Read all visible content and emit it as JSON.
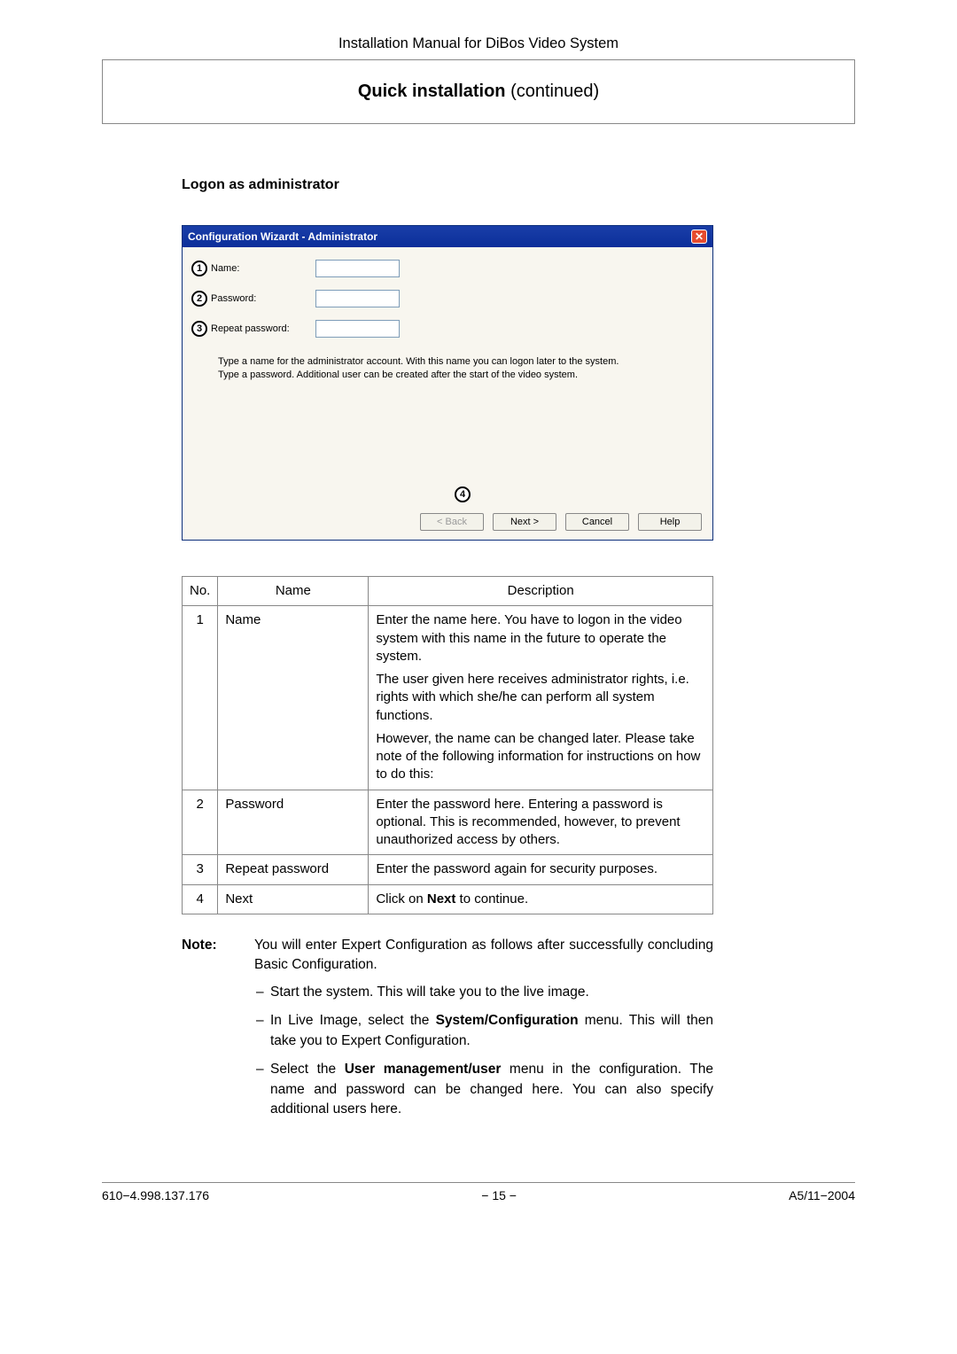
{
  "header": {
    "title": "Installation Manual for DiBos Video System"
  },
  "title_box": {
    "bold": "Quick installation",
    "rest": " (continued)"
  },
  "section": {
    "heading": "Logon as administrator"
  },
  "dialog": {
    "title": "Configuration Wizardt - Administrator",
    "close": "✕",
    "fields": {
      "name_label": "Name:",
      "password_label": "Password:",
      "repeat_label": "Repeat password:",
      "callout1": "1",
      "callout2": "2",
      "callout3": "3",
      "callout4": "4"
    },
    "hint_line1": "Type a name for the administrator account. With this name you can logon later to the system.",
    "hint_line2": "Type a password. Additional user can be created after the start of the video system.",
    "buttons": {
      "back": "< Back",
      "next": "Next >",
      "cancel": "Cancel",
      "help": "Help"
    }
  },
  "table": {
    "headers": {
      "no": "No.",
      "name": "Name",
      "desc": "Description"
    },
    "rows": [
      {
        "no": "1",
        "name": "Name",
        "desc": [
          "Enter the name here. You have to logon in the video system with this name in the future to operate the system.",
          "The user given here receives administrator rights, i.e. rights with which she/he can perform all system functions.",
          "However, the name can be changed later. Please take note of the following information for instructions on how to do this:"
        ]
      },
      {
        "no": "2",
        "name": "Password",
        "desc": [
          "Enter the password here. Entering a password is optional. This is recommended, however, to prevent unauthorized access by others."
        ]
      },
      {
        "no": "3",
        "name": "Repeat password",
        "desc": [
          "Enter the password again for security purposes."
        ]
      },
      {
        "no": "4",
        "name": "Next",
        "desc_html": {
          "pre": "Click on ",
          "bold": "Next",
          "post": " to continue."
        }
      }
    ]
  },
  "note": {
    "label": "Note:",
    "intro": "You will enter Expert Configuration as follows after successfully concluding Basic Configuration.",
    "items": [
      {
        "plain": "Start the system. This will take you to the live image."
      },
      {
        "pre": "In Live Image, select the ",
        "bold": "System/Configuration",
        "post": " menu. This will then take you to Expert Configuration."
      },
      {
        "pre": "Select the ",
        "bold": "User management/user",
        "post": " menu in the configuration. The name and password can be changed here. You can also specify additional users here."
      }
    ]
  },
  "footer": {
    "left": "610−4.998.137.176",
    "center": "− 15 −",
    "right": "A5/11−2004"
  }
}
